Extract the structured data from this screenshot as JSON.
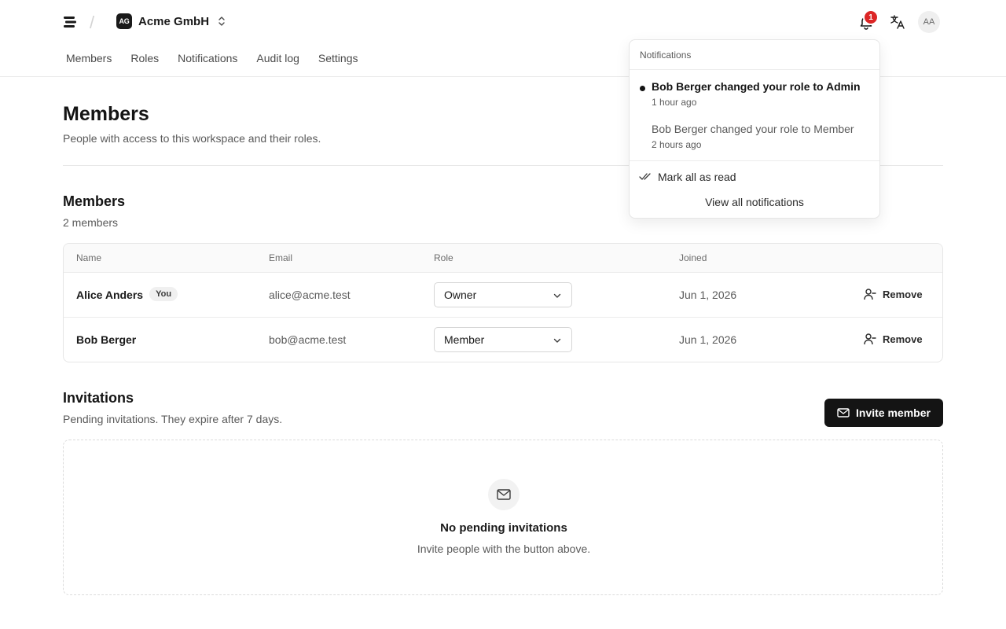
{
  "header": {
    "separator": "/",
    "org": {
      "badge": "AG",
      "name": "Acme GmbH"
    },
    "notification_count": "1",
    "avatar_initials": "AA",
    "icons": [
      "menu-logo-icon",
      "chevron-up-down-icon",
      "bell-icon",
      "translate-icon"
    ]
  },
  "tabs": [
    {
      "label": "Members"
    },
    {
      "label": "Roles"
    },
    {
      "label": "Notifications"
    },
    {
      "label": "Audit log"
    },
    {
      "label": "Settings"
    }
  ],
  "page": {
    "title": "Members",
    "subtitle": "People with access to this workspace and their roles."
  },
  "members": {
    "title": "Members",
    "count": "2 members",
    "columns": {
      "name": "Name",
      "email": "Email",
      "role": "Role",
      "joined": "Joined"
    },
    "rows": [
      {
        "name": "Alice Anders",
        "you_badge": "You",
        "email": "alice@acme.test",
        "role": "Owner",
        "joined": "Jun 1, 2026",
        "remove_label": "Remove"
      },
      {
        "name": "Bob Berger",
        "you_badge": "",
        "email": "bob@acme.test",
        "role": "Member",
        "joined": "Jun 1, 2026",
        "remove_label": "Remove"
      }
    ]
  },
  "invitations": {
    "title": "Invitations",
    "subtitle": "Pending invitations. They expire after 7 days.",
    "invite_button": "Invite member",
    "empty_title": "No pending invitations",
    "empty_subtitle": "Invite people with the button above."
  },
  "notifications_panel": {
    "heading": "Notifications",
    "items": [
      {
        "text": "Bob Berger changed your role to Admin",
        "time": "1 hour ago",
        "unread": true
      },
      {
        "text": "Bob Berger changed your role to Member",
        "time": "2 hours ago",
        "unread": false
      }
    ],
    "mark_all_read": "Mark all as read",
    "view_all": "View all notifications"
  },
  "colors": {
    "primary": "#141414",
    "badge": "#dc2626",
    "border": "#e6e6e6",
    "muted_text": "#5a5a5a"
  }
}
